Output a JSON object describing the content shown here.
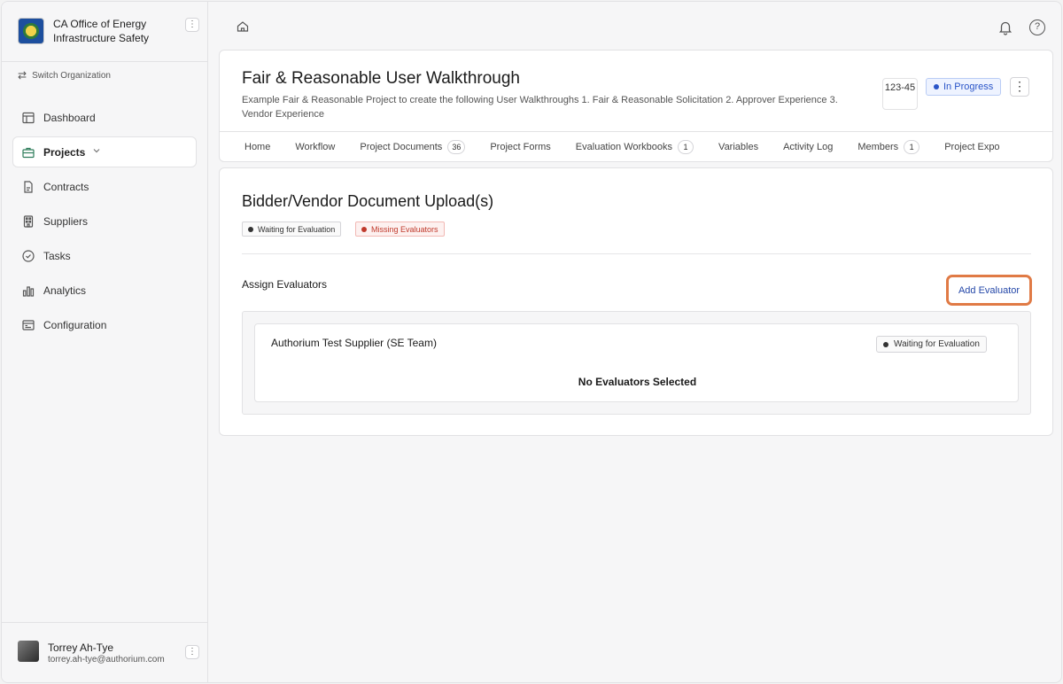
{
  "org": {
    "name": "CA Office of Energy Infrastructure Safety"
  },
  "sidebar": {
    "switch_label": "Switch Organization",
    "items": [
      {
        "label": "Dashboard"
      },
      {
        "label": "Projects"
      },
      {
        "label": "Contracts"
      },
      {
        "label": "Suppliers"
      },
      {
        "label": "Tasks"
      },
      {
        "label": "Analytics"
      },
      {
        "label": "Configuration"
      }
    ]
  },
  "user": {
    "name": "Torrey Ah-Tye",
    "email": "torrey.ah-tye@authorium.com"
  },
  "topbar": {
    "help_label": "?"
  },
  "project": {
    "title": "Fair & Reasonable User Walkthrough",
    "description": "Example Fair & Reasonable Project to create the following User Walkthroughs 1. Fair & Reasonable Solicitation 2. Approver Experience 3. Vendor Experience",
    "id": "123-45",
    "status": "In Progress",
    "status_color": "#2a55c8"
  },
  "tabs": [
    {
      "label": "Home"
    },
    {
      "label": "Workflow"
    },
    {
      "label": "Project Documents",
      "badge": "36"
    },
    {
      "label": "Project Forms"
    },
    {
      "label": "Evaluation Workbooks",
      "badge": "1"
    },
    {
      "label": "Variables"
    },
    {
      "label": "Activity Log"
    },
    {
      "label": "Members",
      "badge": "1"
    },
    {
      "label": "Project Expo"
    }
  ],
  "main": {
    "title": "Bidder/Vendor Document Upload(s)",
    "tags": [
      {
        "label": "Waiting for Evaluation",
        "color": "#333333"
      },
      {
        "label": "Missing Evaluators",
        "color": "#c0392b"
      }
    ],
    "assign_label": "Assign Evaluators",
    "add_button": "Add Evaluator",
    "supplier": {
      "name": "Authorium Test Supplier (SE Team)",
      "status": "Waiting for Evaluation",
      "empty_text": "No Evaluators Selected"
    }
  }
}
